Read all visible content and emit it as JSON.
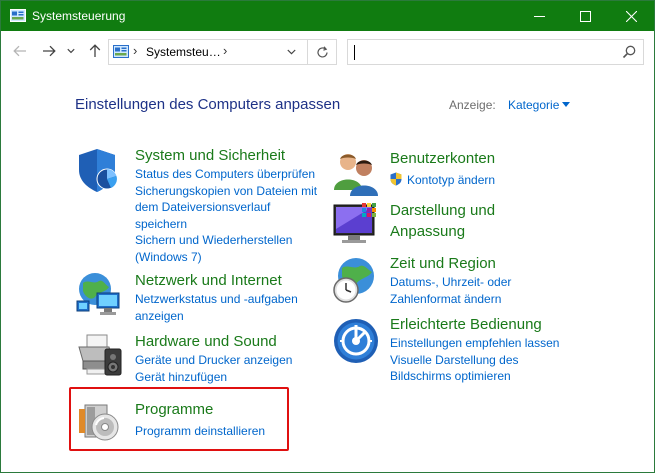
{
  "window": {
    "title": "Systemsteuerung",
    "controls": {
      "minimize": "minimize-icon",
      "maximize": "maximize-icon",
      "close": "close-icon"
    },
    "accent": "#107c10"
  },
  "navbar": {
    "address_text": "Systemsteu…",
    "address_separator": "›",
    "search_value": "",
    "search_placeholder": ""
  },
  "content": {
    "title": "Einstellungen des Computers anpassen",
    "view_label": "Anzeige:",
    "view_value": "Kategorie",
    "left_categories": [
      {
        "heading": "System und Sicherheit",
        "icon": "shield-pie-icon",
        "links": [
          "Status des Computers überprüfen",
          "Sicherungskopien von Dateien mit",
          "dem Dateiversionsverlauf",
          "speichern",
          "Sichern und Wiederherstellen",
          "(Windows 7)"
        ]
      },
      {
        "heading": "Netzwerk und Internet",
        "icon": "network-globe-icon",
        "links": [
          "Netzwerkstatus und -aufgaben",
          "anzeigen"
        ]
      },
      {
        "heading": "Hardware und Sound",
        "icon": "printer-speaker-icon",
        "links": [
          "Geräte und Drucker anzeigen",
          "Gerät hinzufügen"
        ]
      },
      {
        "heading": "Programme",
        "icon": "programs-disc-icon",
        "links": [
          "Programm deinstallieren"
        ]
      }
    ],
    "right_categories": [
      {
        "heading": "Benutzerkonten",
        "icon": "users-icon",
        "links": [
          "Kontotyp ändern"
        ]
      },
      {
        "heading_lines": [
          "Darstellung und",
          "Anpassung"
        ],
        "icon": "display-colors-icon",
        "links": []
      },
      {
        "heading": "Zeit und Region",
        "icon": "clock-globe-icon",
        "links": [
          "Datums-, Uhrzeit- oder",
          "Zahlenformat ändern"
        ]
      },
      {
        "heading": "Erleichterte Bedienung",
        "icon": "ease-of-access-icon",
        "links": [
          "Einstellungen empfehlen lassen",
          "Visuelle Darstellung des",
          "Bildschirms optimieren"
        ]
      }
    ],
    "highlight_color": "#e01010"
  }
}
